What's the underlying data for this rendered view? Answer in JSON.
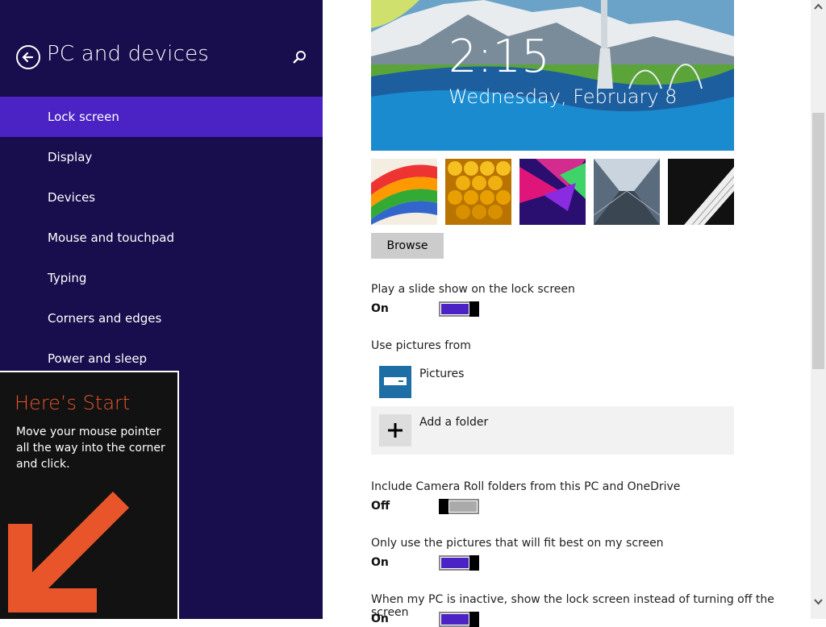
{
  "sidebar": {
    "title": "PC and devices",
    "items": [
      {
        "label": "Lock screen"
      },
      {
        "label": "Display"
      },
      {
        "label": "Devices"
      },
      {
        "label": "Mouse and touchpad"
      },
      {
        "label": "Typing"
      },
      {
        "label": "Corners and edges"
      },
      {
        "label": "Power and sleep"
      }
    ],
    "selected": "Lock screen"
  },
  "tip": {
    "title": "Here’s Start",
    "body": "Move your mouse pointer all the way into the corner and click."
  },
  "preview": {
    "time": "2:15",
    "date": "Wednesday, February 8"
  },
  "browse_label": "Browse",
  "slideshow": {
    "label": "Play a slide show on the lock screen",
    "state": "On"
  },
  "use_pictures": {
    "label": "Use pictures from",
    "folders": [
      {
        "label": "Pictures"
      }
    ],
    "add_label": "Add a folder"
  },
  "camera_roll": {
    "label": "Include Camera Roll folders from this PC and OneDrive",
    "state": "Off"
  },
  "fit_best": {
    "label": "Only use the pictures that will fit best on my screen",
    "state": "On"
  },
  "inactive": {
    "label": "When my PC is inactive, show the lock screen instead of turning off the screen",
    "state": "On"
  },
  "colors": {
    "accent": "#4b22c4",
    "sidebar_bg": "#180d4d",
    "tip_title": "#e8552b"
  }
}
